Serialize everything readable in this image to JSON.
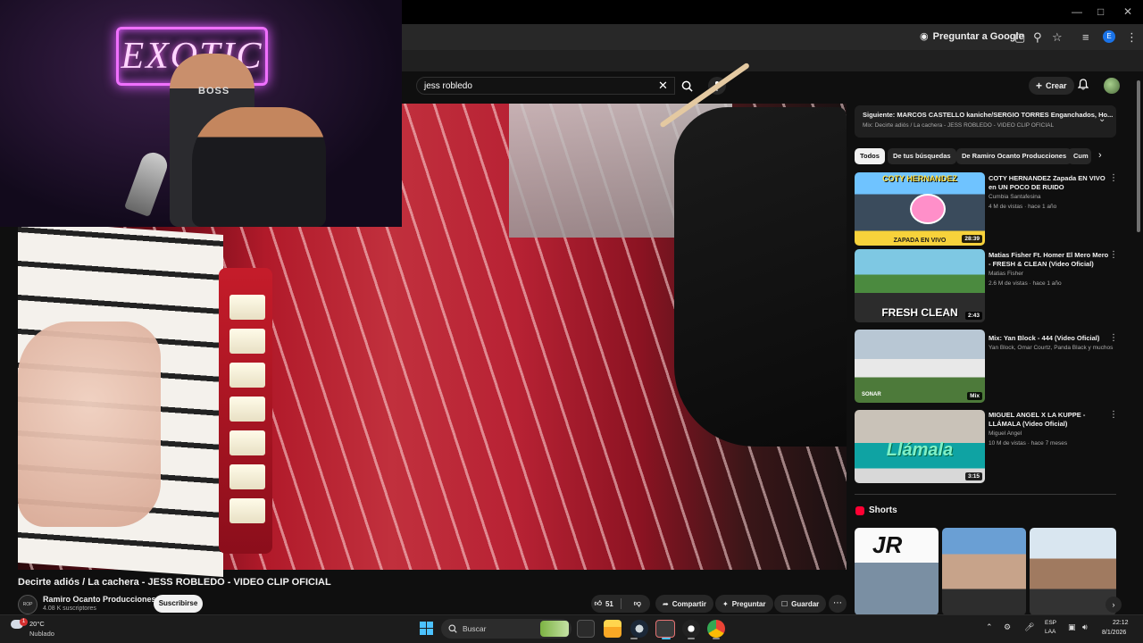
{
  "browser": {
    "ask_google_label": "Preguntar a Google",
    "profile_initial": "E"
  },
  "youtube": {
    "search": {
      "query": "jess robledo"
    },
    "create_label": "Crear"
  },
  "facecam": {
    "neon_sign_text": "EXOTIC",
    "shirt_text": "BOSS"
  },
  "video": {
    "title": "Decirte adiós / La cachera - JESS ROBLEDO - VIDEO CLIP OFICIAL",
    "channel_name": "Ramiro Ocanto Producciones",
    "subscribers": "4.08 K suscriptores",
    "subscribe_label": "Suscribirse",
    "likes": "51",
    "share_label": "Compartir",
    "ask_label": "Preguntar",
    "save_label": "Guardar"
  },
  "playlist": {
    "next_title": "Siguiente: MARCOS CASTELLO kaniche/SERGIO TORRES Enganchados, Ho...",
    "mix_subtitle": "Mix: Decirte adiós / La cachera - JESS ROBLEDO - VIDEO CLIP OFICIAL"
  },
  "chips": [
    {
      "label": "Todos"
    },
    {
      "label": "De tus búsquedas"
    },
    {
      "label": "De Ramiro Ocanto Producciones"
    },
    {
      "label": "Cum"
    }
  ],
  "recommendations": [
    {
      "title": "COTY HERNANDEZ Zapada EN VIVO en UN POCO DE RUIDO",
      "channel": "Cumbia Santafesina",
      "meta": "4 M de vistas · hace 1 año",
      "duration": "28:39",
      "thumb_text_top": "COTY HERNANDEZ",
      "thumb_text_bottom": "ZAPADA EN VIVO"
    },
    {
      "title": "Matias Fisher Ft. Homer El Mero Mero - FRESH & CLEAN (Video Oficial)",
      "channel": "Matias Fisher",
      "meta": "2.6 M de vistas · hace 1 año",
      "duration": "2:43",
      "thumb_text_bottom": "FRESH CLEAN"
    },
    {
      "title": "Mix: Yan Block - 444 (Video Oficial)",
      "channel": "Yan Block, Omar Courtz, Panda Black y muchos ...",
      "meta": "",
      "duration": "Mix",
      "thumb_text_bottom": "SONAR"
    },
    {
      "title": "MIGUEL ANGEL X LA KUPPE - LLÁMALA (Video Oficial)",
      "channel": "Miguel Angel",
      "meta": "10 M de vistas · hace 7 meses",
      "duration": "3:15",
      "thumb_text_bottom": "Llámala"
    }
  ],
  "shorts": {
    "title": "Shorts",
    "first_short_text": "JR"
  },
  "taskbar": {
    "weather_temp": "20°C",
    "weather_condition": "Nublado",
    "weather_badge": "1",
    "search_placeholder": "Buscar",
    "lang_top": "ESP",
    "lang_bottom": "LAA",
    "time": "22:12",
    "date": "8/1/2026"
  },
  "colors": {
    "youtube_bg": "#0f0f0f",
    "chip_bg": "#272727",
    "youtube_red": "#ff0033",
    "accent_blue": "#4cc2ff"
  }
}
